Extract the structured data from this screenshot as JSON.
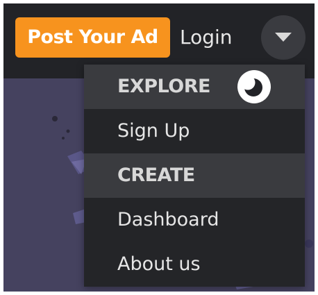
{
  "header": {
    "post_ad_label": "Post Your Ad",
    "login_label": "Login"
  },
  "menu": {
    "sections": [
      {
        "header": "EXPLORE",
        "items": [
          "Sign Up"
        ]
      },
      {
        "header": "CREATE",
        "items": [
          "Dashboard",
          "About us"
        ]
      }
    ]
  },
  "colors": {
    "accent": "#f7931e",
    "topbar": "#222327",
    "menu_bg": "#242528",
    "menu_header_bg": "#3a3b3f",
    "page_bg": "#45425f"
  },
  "icons": {
    "toggle": "caret-down-icon",
    "theme": "moon-icon"
  }
}
